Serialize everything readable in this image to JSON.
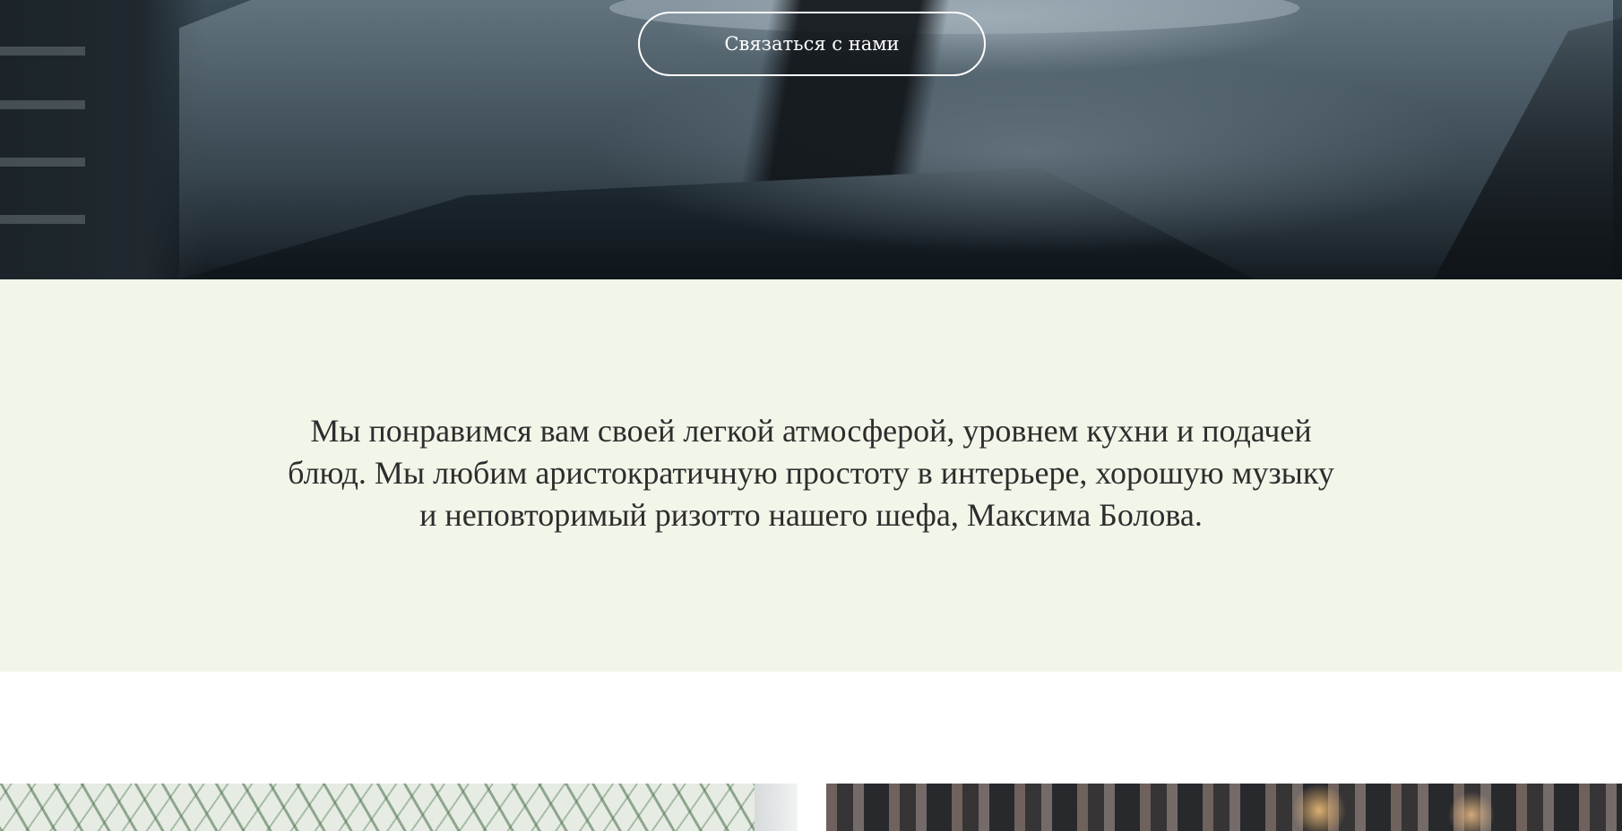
{
  "hero": {
    "contact_button_label": "Связаться с нами"
  },
  "about": {
    "text": "Мы понравимся вам своей легкой атмосферой, уровнем кухни и подачей блюд. Мы любим аристократичную простоту в интерьере, хорошую музыку и неповторимый ризотто нашего шефа, Максима Болова."
  },
  "colors": {
    "about_background": "#f2f6e9",
    "about_text": "#2d2d2d",
    "button_border": "#ffffff"
  }
}
